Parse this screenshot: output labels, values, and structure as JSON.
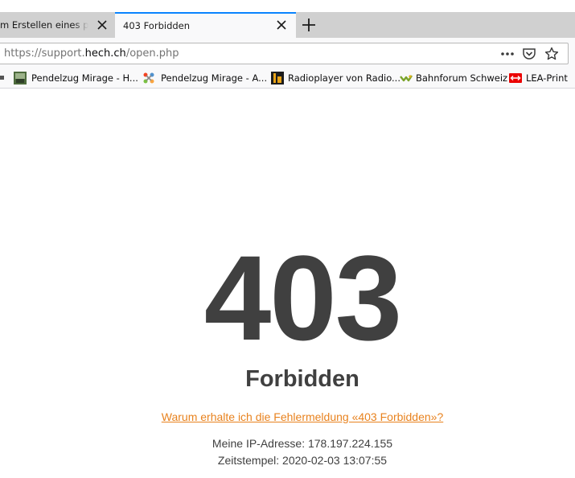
{
  "tabs": [
    {
      "label": "m Erstellen eines pdf",
      "active": false
    },
    {
      "label": "403 Forbidden",
      "active": true
    }
  ],
  "address_bar": {
    "scheme_prefix": "https://support.",
    "host": "hech.ch",
    "path": "/open.php"
  },
  "bookmarks": [
    {
      "label": "Pendelzug Mirage - H...",
      "icon": "photo-thumbnail-icon"
    },
    {
      "label": "Pendelzug Mirage - A...",
      "icon": "joomla-icon"
    },
    {
      "label": "Radioplayer von Radio...",
      "icon": "radio-logo-icon"
    },
    {
      "label": "Bahnforum Schweiz",
      "icon": "bahnforum-icon"
    },
    {
      "label": "LEA-Print",
      "icon": "sbb-icon"
    }
  ],
  "page": {
    "code": "403",
    "status": "Forbidden",
    "help_link": "Warum erhalte ich die Fehlermeldung «403 Forbidden»?",
    "ip_line": "Meine IP-Adresse: 178.197.224.155",
    "timestamp_line": "Zeitstempel: 2020-02-03 13:07:55"
  },
  "colors": {
    "accent_tab": "#0a84ff",
    "link": "#e8821e",
    "heading": "#404040"
  }
}
